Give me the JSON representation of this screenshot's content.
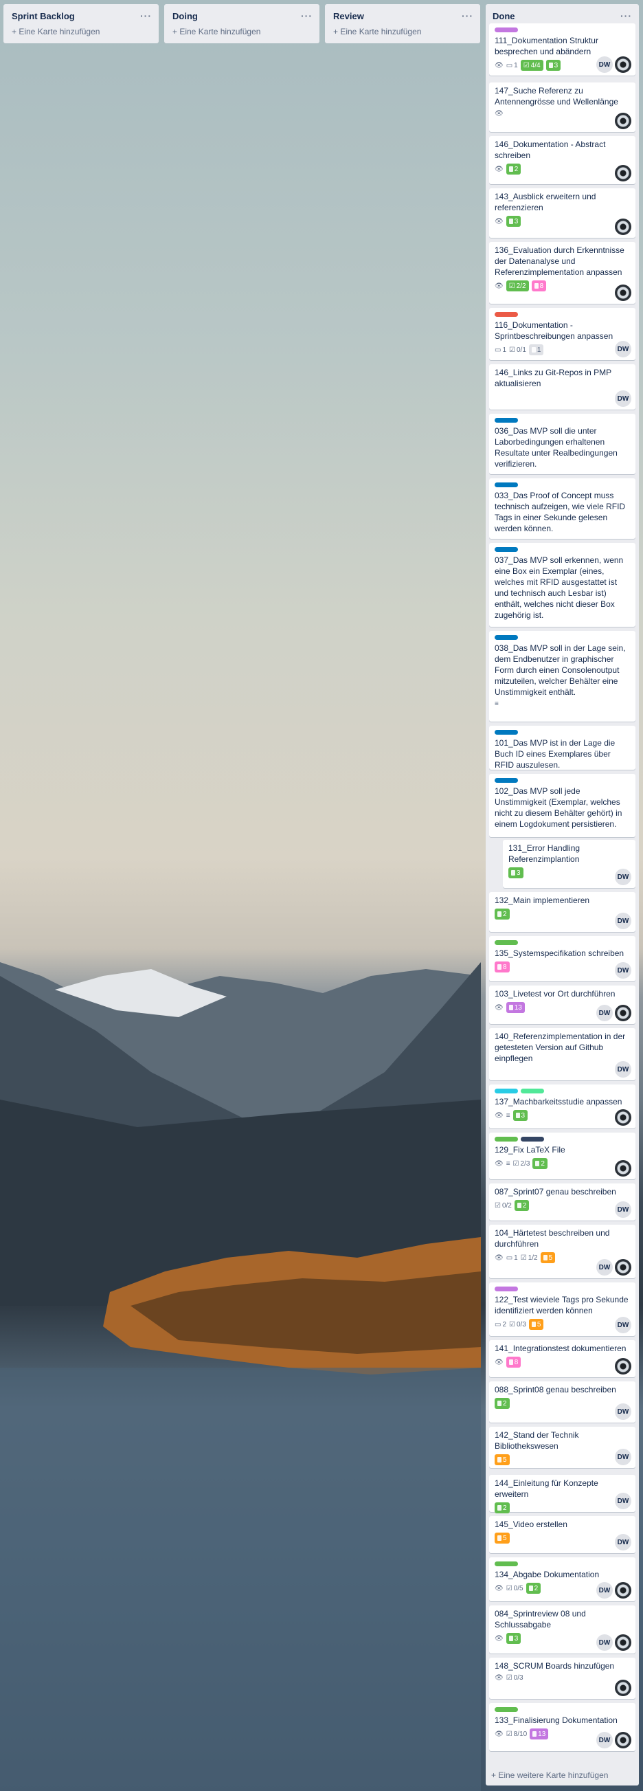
{
  "lists": [
    {
      "title": "Sprint Backlog",
      "add_label": "+ Eine Karte hinzufügen"
    },
    {
      "title": "Doing",
      "add_label": "+ Eine Karte hinzufügen"
    },
    {
      "title": "Review",
      "add_label": "+ Eine Karte hinzufügen"
    }
  ],
  "done": {
    "title": "Done",
    "menu": "···",
    "add_label": "+ Eine weitere Karte hinzufügen",
    "cards": [
      {
        "title": "111_Dokumentation Struktur besprechen und abändern",
        "labels": [
          "#c377e0"
        ],
        "badges": [
          {
            "t": "eye"
          },
          {
            "t": "comment",
            "v": "1"
          },
          {
            "t": "check",
            "v": "4/4",
            "c": "#61bd4f"
          },
          {
            "t": "pill",
            "v": "3",
            "c": "#61bd4f"
          }
        ],
        "members": [
          "DW",
          "eye"
        ]
      },
      {
        "title": "147_Suche Referenz zu Antennengrösse und Wellenlänge",
        "labels": [],
        "badges": [
          {
            "t": "eye"
          }
        ],
        "members": [
          "eye"
        ]
      },
      {
        "title": "146_Dokumentation - Abstract schreiben",
        "labels": [],
        "badges": [
          {
            "t": "eye"
          },
          {
            "t": "pill",
            "v": "2",
            "c": "#61bd4f"
          }
        ],
        "members": [
          "eye"
        ]
      },
      {
        "title": "143_Ausblick erweitern und referenzieren",
        "labels": [],
        "badges": [
          {
            "t": "eye"
          },
          {
            "t": "pill",
            "v": "3",
            "c": "#61bd4f"
          }
        ],
        "members": [
          "eye"
        ]
      },
      {
        "title": "136_Evaluation durch Erkenntnisse der Datenanalyse und Referenzimplementation anpassen",
        "labels": [],
        "badges": [
          {
            "t": "eye"
          },
          {
            "t": "check",
            "v": "2/2",
            "c": "#61bd4f"
          },
          {
            "t": "pill",
            "v": "8",
            "c": "#ff78cb"
          }
        ],
        "members": [
          "eye"
        ]
      },
      {
        "title": "116_Dokumentation - Sprintbeschreibungen anpassen",
        "labels": [
          "#eb5a46"
        ],
        "badges": [
          {
            "t": "comment",
            "v": "1"
          },
          {
            "t": "check",
            "v": "0/1"
          },
          {
            "t": "pill",
            "v": "1",
            "c": "#dfe1e6"
          }
        ],
        "members": [
          "DW"
        ]
      },
      {
        "title": "146_Links zu Git-Repos in PMP aktualisieren",
        "labels": [],
        "badges": [],
        "members": [
          "DW"
        ]
      },
      {
        "title": "036_Das MVP soll die unter Laborbedingungen erhaltenen Resultate unter Realbedingungen verifizieren.",
        "labels": [
          "#0079bf"
        ],
        "badges": [],
        "members": []
      },
      {
        "title": "033_Das Proof of Concept muss technisch aufzeigen, wie viele RFID Tags in einer Sekunde gelesen werden können.",
        "labels": [
          "#0079bf"
        ],
        "badges": [],
        "members": []
      },
      {
        "title": "037_Das MVP soll erkennen, wenn eine Box ein Exemplar (eines, welches mit RFID ausgestattet ist und technisch auch Lesbar ist) enthält, welches nicht dieser Box zugehörig ist.",
        "labels": [
          "#0079bf"
        ],
        "badges": [],
        "members": []
      },
      {
        "title": "038_Das MVP soll in der Lage sein, dem Endbenutzer in graphischer Form durch einen Consolenoutput mitzuteilen, welcher Behälter eine Unstimmigkeit enthält.",
        "labels": [
          "#0079bf"
        ],
        "badges": [
          {
            "t": "desc"
          }
        ],
        "members": []
      },
      {
        "title": "101_Das MVP ist in der Lage die Buch ID eines Exemplares über RFID auszulesen.",
        "labels": [
          "#0079bf"
        ],
        "badges": [],
        "members": []
      },
      {
        "title": "102_Das MVP soll jede Unstimmigkeit (Exemplar, welches nicht zu diesem Behälter gehört) in einem Logdokument persistieren.",
        "labels": [
          "#0079bf"
        ],
        "badges": [],
        "members": []
      },
      {
        "title": "131_Error Handling Referenzimplantion",
        "labels": [],
        "badges": [
          {
            "t": "pill",
            "v": "3",
            "c": "#61bd4f"
          }
        ],
        "members": [
          "DW"
        ],
        "indent": true
      },
      {
        "title": "132_Main implementieren",
        "labels": [],
        "badges": [
          {
            "t": "pill",
            "v": "2",
            "c": "#61bd4f"
          }
        ],
        "members": [
          "DW"
        ]
      },
      {
        "title": "135_Systemspecifikation schreiben",
        "labels": [
          "#61bd4f"
        ],
        "badges": [
          {
            "t": "pill",
            "v": "8",
            "c": "#ff78cb"
          }
        ],
        "members": [
          "DW"
        ]
      },
      {
        "title": "103_Livetest vor Ort durchführen",
        "labels": [],
        "badges": [
          {
            "t": "eye"
          },
          {
            "t": "pill",
            "v": "13",
            "c": "#c377e0"
          }
        ],
        "members": [
          "DW",
          "eye"
        ]
      },
      {
        "title": "140_Referenzimplementation in der getesteten Version auf Github einpflegen",
        "labels": [],
        "badges": [],
        "members": [
          "DW"
        ]
      },
      {
        "title": "137_Machbarkeitsstudie anpassen",
        "labels": [
          "#29cce5",
          "#51e898"
        ],
        "badges": [
          {
            "t": "eye"
          },
          {
            "t": "desc"
          },
          {
            "t": "pill",
            "v": "3",
            "c": "#61bd4f"
          }
        ],
        "members": [
          "eye"
        ]
      },
      {
        "title": "129_Fix LaTeX File",
        "labels": [
          "#61bd4f",
          "#344563"
        ],
        "badges": [
          {
            "t": "eye"
          },
          {
            "t": "desc"
          },
          {
            "t": "check",
            "v": "2/3"
          },
          {
            "t": "pill",
            "v": "2",
            "c": "#61bd4f"
          }
        ],
        "members": [
          "eye"
        ]
      },
      {
        "title": "087_Sprint07 genau beschreiben",
        "labels": [],
        "badges": [
          {
            "t": "check",
            "v": "0/2"
          },
          {
            "t": "pill",
            "v": "2",
            "c": "#61bd4f"
          }
        ],
        "members": [
          "DW"
        ]
      },
      {
        "title": "104_Härtetest beschreiben und durchführen",
        "labels": [],
        "badges": [
          {
            "t": "eye"
          },
          {
            "t": "comment",
            "v": "1"
          },
          {
            "t": "check",
            "v": "1/2"
          },
          {
            "t": "pill",
            "v": "5",
            "c": "#ff9f1a"
          }
        ],
        "members": [
          "DW",
          "eye"
        ]
      },
      {
        "title": "122_Test wieviele Tags pro Sekunde identifiziert werden können",
        "labels": [
          "#c377e0"
        ],
        "badges": [
          {
            "t": "comment",
            "v": "2"
          },
          {
            "t": "check",
            "v": "0/3"
          },
          {
            "t": "pill",
            "v": "5",
            "c": "#ff9f1a"
          }
        ],
        "members": [
          "DW"
        ]
      },
      {
        "title": "141_Integrationstest dokumentieren",
        "labels": [],
        "badges": [
          {
            "t": "eye"
          },
          {
            "t": "pill",
            "v": "8",
            "c": "#ff78cb"
          }
        ],
        "members": [
          "eye"
        ]
      },
      {
        "title": "088_Sprint08 genau beschreiben",
        "labels": [],
        "badges": [
          {
            "t": "pill",
            "v": "2",
            "c": "#61bd4f"
          }
        ],
        "members": [
          "DW"
        ]
      },
      {
        "title": "142_Stand der Technik Bibliothekswesen",
        "labels": [],
        "badges": [
          {
            "t": "pill",
            "v": "5",
            "c": "#ff9f1a"
          }
        ],
        "members": [
          "DW"
        ]
      },
      {
        "title": "144_Einleitung für Konzepte erweitern",
        "labels": [],
        "badges": [
          {
            "t": "pill",
            "v": "2",
            "c": "#61bd4f"
          }
        ],
        "members": [
          "DW"
        ]
      },
      {
        "title": "145_Video erstellen",
        "labels": [],
        "badges": [
          {
            "t": "pill",
            "v": "5",
            "c": "#ff9f1a"
          }
        ],
        "members": [
          "DW"
        ]
      },
      {
        "title": "134_Abgabe Dokumentation",
        "labels": [
          "#61bd4f"
        ],
        "badges": [
          {
            "t": "eye"
          },
          {
            "t": "check",
            "v": "0/5"
          },
          {
            "t": "pill",
            "v": "2",
            "c": "#61bd4f"
          }
        ],
        "members": [
          "DW",
          "eye"
        ]
      },
      {
        "title": "084_Sprintreview 08 und Schlussabgabe",
        "labels": [],
        "badges": [
          {
            "t": "eye"
          },
          {
            "t": "pill",
            "v": "3",
            "c": "#61bd4f"
          }
        ],
        "members": [
          "DW",
          "eye"
        ]
      },
      {
        "title": "148_SCRUM Boards hinzufügen",
        "labels": [],
        "badges": [
          {
            "t": "eye"
          },
          {
            "t": "check",
            "v": "0/3"
          }
        ],
        "members": [
          "eye"
        ]
      },
      {
        "title": "133_Finalisierung Dokumentation",
        "labels": [
          "#61bd4f"
        ],
        "badges": [
          {
            "t": "eye"
          },
          {
            "t": "check",
            "v": "8/10"
          },
          {
            "t": "pill",
            "v": "13",
            "c": "#c377e0"
          }
        ],
        "members": [
          "DW",
          "eye"
        ]
      }
    ]
  }
}
